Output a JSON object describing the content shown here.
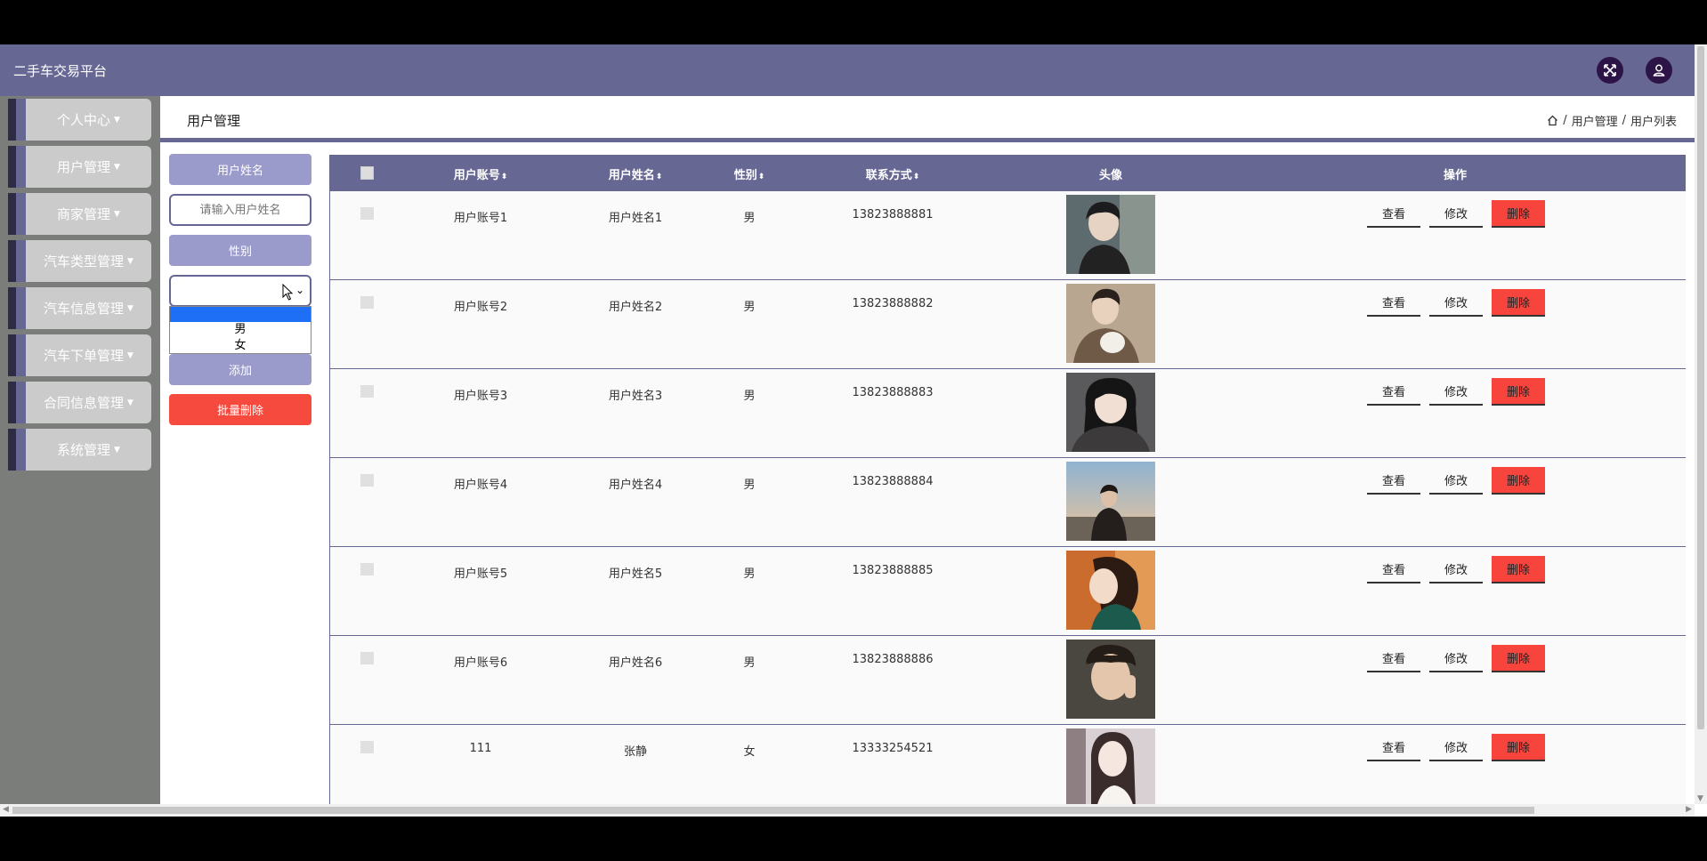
{
  "app": {
    "title": "二手车交易平台"
  },
  "header": {
    "fullscreen_icon": "fullscreen-icon",
    "user_icon": "user-icon"
  },
  "sidebar": {
    "items": [
      {
        "label": "个人中心"
      },
      {
        "label": "用户管理"
      },
      {
        "label": "商家管理"
      },
      {
        "label": "汽车类型管理"
      },
      {
        "label": "汽车信息管理"
      },
      {
        "label": "汽车下单管理"
      },
      {
        "label": "合同信息管理"
      },
      {
        "label": "系统管理"
      }
    ]
  },
  "page": {
    "title": "用户管理",
    "breadcrumb": {
      "home_icon": "home-icon",
      "sep": "/",
      "level1": "用户管理",
      "level2": "用户列表"
    }
  },
  "search": {
    "name_label": "用户姓名",
    "name_placeholder": "请输入用户姓名",
    "name_value": "",
    "gender_label": "性别",
    "gender_selected": "",
    "gender_options": [
      "",
      "男",
      "女"
    ],
    "add_label": "添加",
    "batch_delete_label": "批量删除"
  },
  "table": {
    "headers": {
      "account": "用户账号",
      "name": "用户姓名",
      "gender": "性别",
      "phone": "联系方式",
      "avatar": "头像",
      "actions": "操作"
    },
    "sort_icon": "sort-icon",
    "actions": {
      "view": "查看",
      "edit": "修改",
      "delete": "删除"
    },
    "rows": [
      {
        "account": "用户账号1",
        "name": "用户姓名1",
        "gender": "男",
        "phone": "13823888881"
      },
      {
        "account": "用户账号2",
        "name": "用户姓名2",
        "gender": "男",
        "phone": "13823888882"
      },
      {
        "account": "用户账号3",
        "name": "用户姓名3",
        "gender": "男",
        "phone": "13823888883"
      },
      {
        "account": "用户账号4",
        "name": "用户姓名4",
        "gender": "男",
        "phone": "13823888884"
      },
      {
        "account": "用户账号5",
        "name": "用户姓名5",
        "gender": "男",
        "phone": "13823888885"
      },
      {
        "account": "用户账号6",
        "name": "用户姓名6",
        "gender": "男",
        "phone": "13823888886"
      },
      {
        "account": "111",
        "name": "张静",
        "gender": "女",
        "phone": "13333254521"
      }
    ]
  },
  "colors": {
    "primary": "#676794",
    "accent_light": "#9a9bcb",
    "danger": "#f74a3f",
    "sidebar_bg": "#7b7d7b"
  }
}
